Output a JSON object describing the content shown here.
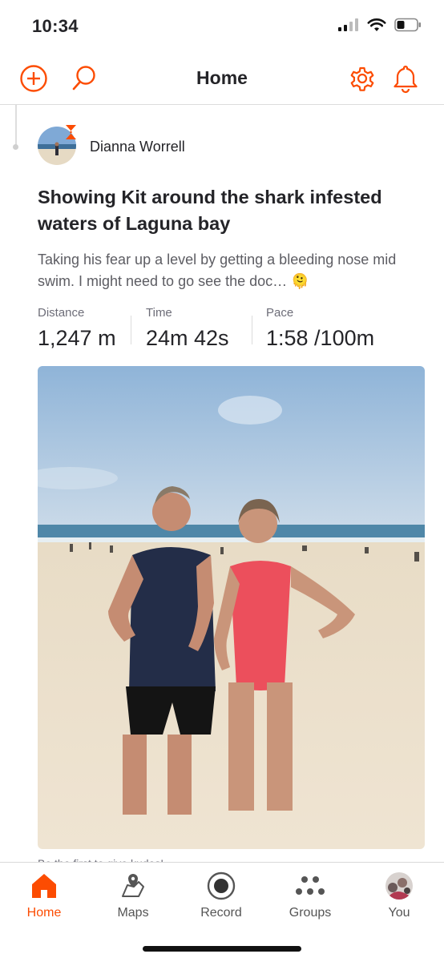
{
  "status_bar": {
    "time": "10:34"
  },
  "header": {
    "title": "Home"
  },
  "post": {
    "author": "Dianna Worrell",
    "title": "Showing Kit around the shark infested waters of Laguna bay",
    "description": "Taking his fear up a level by getting a bleeding nose mid swim. I might need to go see the doc… 🫠",
    "stats": [
      {
        "label": "Distance",
        "value": "1,247 m"
      },
      {
        "label": "Time",
        "value": "24m 42s"
      },
      {
        "label": "Pace",
        "value": "1:58 /100m"
      }
    ],
    "photo_caption_partial": "Be the first to give kudos!"
  },
  "tabs": [
    {
      "label": "Home",
      "icon": "home-icon",
      "active": true
    },
    {
      "label": "Maps",
      "icon": "map-icon",
      "active": false
    },
    {
      "label": "Record",
      "icon": "record-icon",
      "active": false
    },
    {
      "label": "Groups",
      "icon": "groups-icon",
      "active": false
    },
    {
      "label": "You",
      "icon": "profile-avatar",
      "active": false
    }
  ],
  "colors": {
    "accent": "#fc4c02",
    "text": "#242428",
    "muted": "#6d6d78"
  }
}
